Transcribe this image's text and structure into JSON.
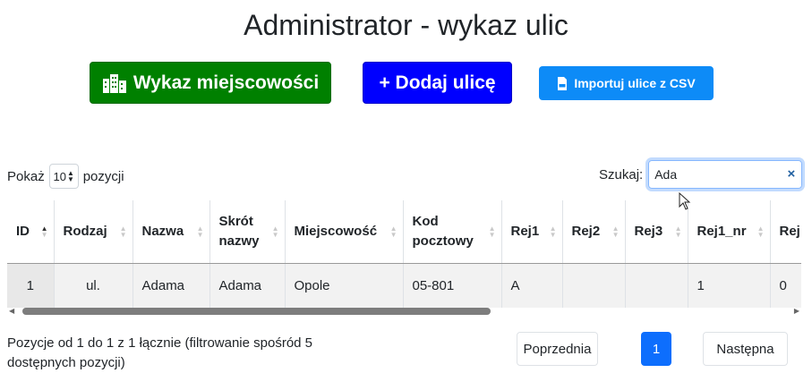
{
  "page": {
    "title": "Administrator - wykaz ulic"
  },
  "toolbar": {
    "towns_label": "Wykaz miejscowości",
    "add_label": "+ Dodaj ulicę",
    "csv_label": "Importuj ulice z CSV",
    "icons": [
      "city-icon",
      "csv-file-icon"
    ],
    "colors": {
      "towns": "#008000",
      "add": "#0000ff",
      "csv": "#0d8bf7"
    }
  },
  "length": {
    "prefix": "Pokaż",
    "value": "10",
    "suffix": "pozycji"
  },
  "search": {
    "label": "Szukaj:",
    "value": "Ada"
  },
  "table": {
    "headers": [
      "ID",
      "Rodzaj",
      "Nazwa",
      "Skrót nazwy",
      "Miejscowość",
      "Kod pocztowy",
      "Rej1",
      "Rej2",
      "Rej3",
      "Rej1_nr",
      "Rej"
    ],
    "rows": [
      [
        "1",
        "ul.",
        "Adama",
        "Adama",
        "Opole",
        "05-801",
        "A",
        "",
        "",
        "1",
        "0"
      ]
    ]
  },
  "footer": {
    "info": "Pozycje od 1 do 1 z 1 łącznie (filtrowanie spośród 5 dostępnych pozycji)",
    "prev": "Poprzednia",
    "current": "1",
    "next": "Następna"
  }
}
